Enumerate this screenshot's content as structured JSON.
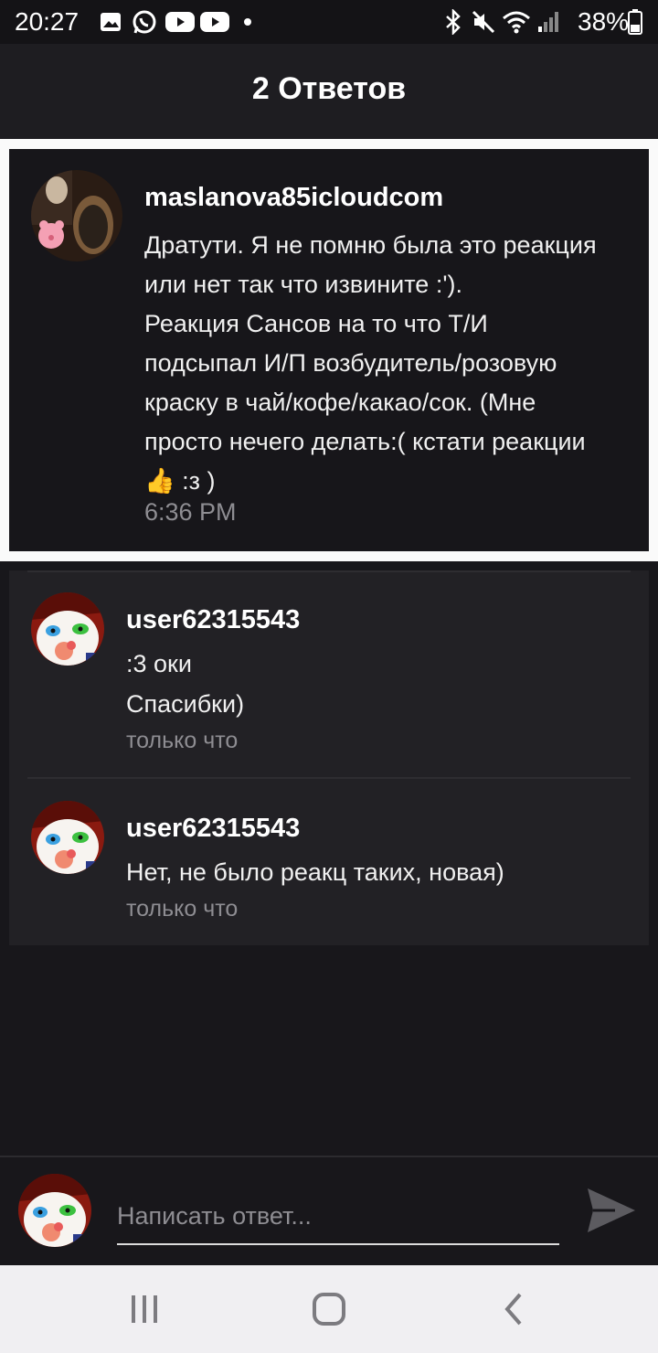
{
  "status_bar": {
    "time": "20:27",
    "battery_percent": "38%",
    "icons": [
      "gallery-icon",
      "whatsapp-icon",
      "youtube-icon",
      "youtube-icon",
      "dot-icon",
      "bluetooth-icon",
      "mute-icon",
      "wifi-icon",
      "signal-icon",
      "battery-icon"
    ]
  },
  "header": {
    "title": "2 Ответов"
  },
  "original_comment": {
    "username": "maslanova85icloudcom",
    "lines": [
      "Дратути. Я не помню была это реакция",
      "или нет так что извините :').",
      "Реакция Сансов на то что Т/И",
      "подсыпал И/П возбудитель/розовую",
      "краску в чай/кофе/какао/сок. (Мне",
      "просто нечего делать:( кстати реакции",
      "👍 :з )"
    ],
    "time": "6:36 PM"
  },
  "replies": [
    {
      "username": "user62315543",
      "lines": [
        ":3 оки",
        "Спасибки)"
      ],
      "time": "только что"
    },
    {
      "username": "user62315543",
      "lines": [
        "Нет, не было реакц таких, новая)"
      ],
      "time": "только что"
    }
  ],
  "composer": {
    "placeholder": "Написать ответ..."
  },
  "colors": {
    "background": "#18171b",
    "card": "#222125",
    "muted_text": "#8e8d92",
    "frame": "#fafafa"
  }
}
